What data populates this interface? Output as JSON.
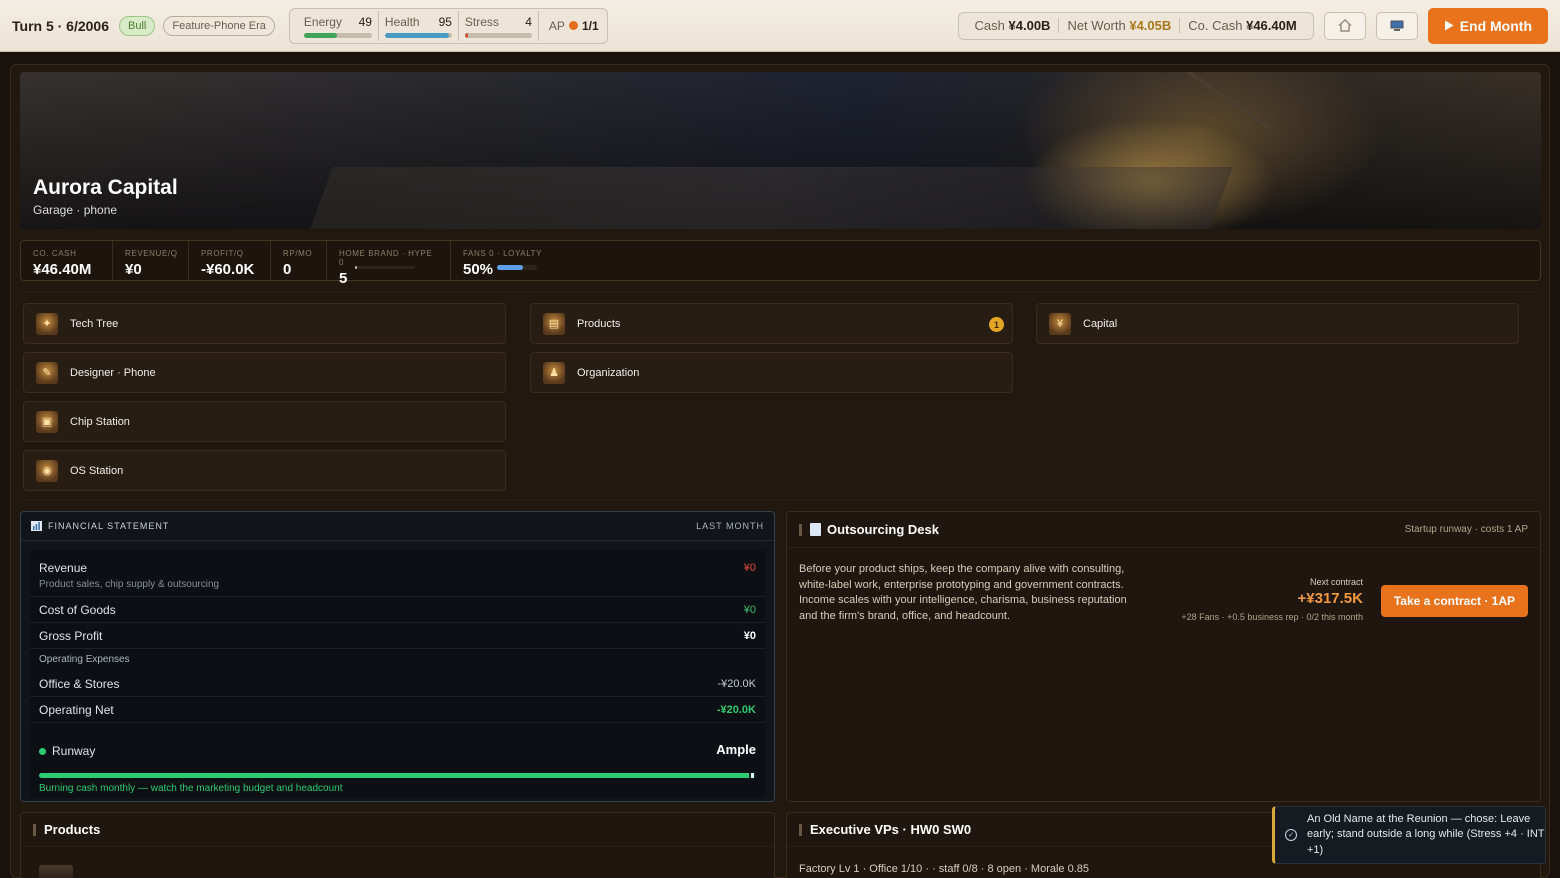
{
  "topbar": {
    "turn": "Turn 5 · 6/2006",
    "market_pill": "Bull",
    "era_pill": "Feature-Phone Era",
    "stats": [
      {
        "label": "Energy",
        "value": "49",
        "level": 0.49,
        "color": "#3fa35a"
      },
      {
        "label": "Health",
        "value": "95",
        "level": 0.95,
        "color": "#4a9bc4"
      },
      {
        "label": "Stress",
        "value": "4",
        "level": 0.04,
        "color": "#c9503a"
      }
    ],
    "ap_label": "AP",
    "ap_value": "1/1",
    "cash_label": "Cash",
    "cash_value": "¥4.00B",
    "networth_label": "Net Worth",
    "networth_value": "¥4.05B",
    "cocash_label": "Co. Cash",
    "cocash_value": "¥46.40M",
    "home_icon": "home-icon",
    "computer_icon": "computer-icon",
    "end_month": "End Month"
  },
  "company": {
    "name": "Aurora Capital",
    "subtitle": "Garage · phone"
  },
  "kpis": [
    {
      "key": "CO. CASH",
      "value": "¥46.40M"
    },
    {
      "key": "REVENUE/Q",
      "value": "¥0"
    },
    {
      "key": "PROFIT/Q",
      "value": "-¥60.0K"
    },
    {
      "key": "RP/MO",
      "value": "0"
    },
    {
      "key": "HOME BRAND · HYPE 0",
      "value": "5"
    },
    {
      "key": "FANS 0 · LOYALTY",
      "value": "50%"
    }
  ],
  "nav": {
    "tech_tree": "Tech Tree",
    "designer": "Designer · Phone",
    "chip_station": "Chip Station",
    "os_station": "OS Station",
    "products": "Products",
    "products_badge": "1",
    "organization": "Organization",
    "capital": "Capital"
  },
  "financial": {
    "title": "FINANCIAL STATEMENT",
    "period": "LAST MONTH",
    "revenue_label": "Revenue",
    "revenue_sub": "Product sales, chip supply & outsourcing",
    "revenue_value": "¥0",
    "cogs_label": "Cost of Goods",
    "cogs_value": "¥0",
    "gross_label": "Gross Profit",
    "gross_value": "¥0",
    "opex_label": "Operating Expenses",
    "office_label": "Office & Stores",
    "office_value": "-¥20.0K",
    "opnet_label": "Operating Net",
    "opnet_value": "-¥20.0K",
    "runway_label": "Runway",
    "runway_value": "Ample",
    "runway_level": 0.99,
    "runway_note": "Burning cash monthly — watch the marketing budget and headcount"
  },
  "outsourcing": {
    "title": "Outsourcing Desk",
    "subtitle": "Startup runway · costs 1 AP",
    "description": "Before your product ships, keep the company alive with consulting, white-label work, enterprise prototyping and government contracts. Income scales with your intelligence, charisma, business reputation and the firm's brand, office, and headcount.",
    "next_label": "Next contract",
    "amount": "+¥317.5K",
    "fine": "+28 Fans · +0.5 business rep · 0/2 this month",
    "button": "Take a contract · 1AP"
  },
  "products_panel": {
    "title": "Products"
  },
  "vps": {
    "title": "Executive VPs · HW0 SW0",
    "line": "Factory Lv 1 · Office 1/10 · · staff 0/8 · 8 open · Morale 0.85"
  },
  "toast": {
    "message": "An Old Name at the Reunion — chose: Leave early; stand outside a long while (Stress +4 · INT +1)"
  }
}
